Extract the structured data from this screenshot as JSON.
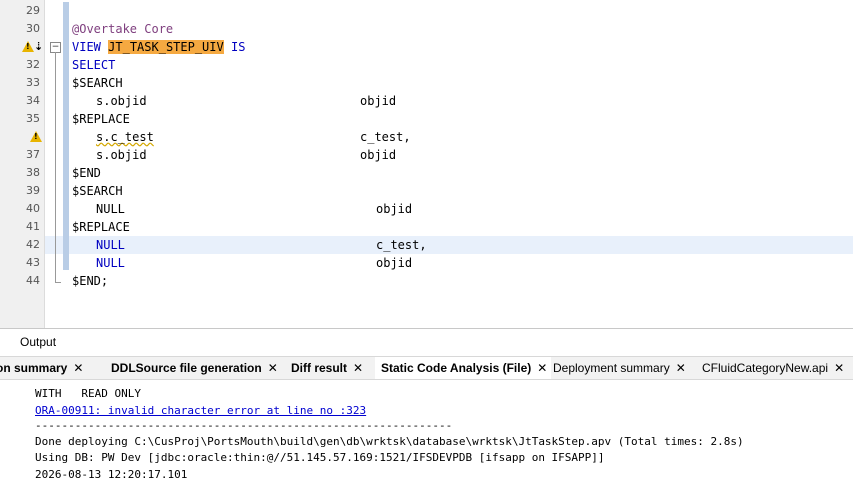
{
  "editor": {
    "lines": [
      {
        "n": "29",
        "t": ""
      },
      {
        "n": "30",
        "t": "@Overtake Core"
      },
      {
        "n": "",
        "t": "VIEW JT_TASK_STEP_UIV IS"
      },
      {
        "n": "32",
        "t": "SELECT"
      },
      {
        "n": "33",
        "t": "$SEARCH"
      },
      {
        "n": "34",
        "t": "   s.objid                               objid"
      },
      {
        "n": "35",
        "t": "$REPLACE"
      },
      {
        "n": "",
        "t": "   s.c_test                              c_test,"
      },
      {
        "n": "37",
        "t": "   s.objid                               objid"
      },
      {
        "n": "38",
        "t": "$END"
      },
      {
        "n": "39",
        "t": "$SEARCH"
      },
      {
        "n": "40",
        "t": "   NULL                                    objid"
      },
      {
        "n": "41",
        "t": "$REPLACE"
      },
      {
        "n": "42",
        "t": "   NULL                                    c_test,"
      },
      {
        "n": "43",
        "t": "   NULL                                    objid"
      },
      {
        "n": "44",
        "t": "$END;"
      }
    ],
    "view_keyword": "VIEW",
    "view_name": "JT_TASK_STEP_UIV",
    "view_is": "IS",
    "annotation": "@Overtake Core",
    "col_objid": "objid",
    "col_ctest": "c_test,",
    "s_objid": "s.objid",
    "s_ctest": "s.c_test",
    "null_kw": "NULL",
    "fold_minus": "−",
    "warning_icon_name": "warning-icon",
    "highlight_color": "#f5a941",
    "keyword_color": "#0000c0"
  },
  "output": {
    "title": "Output",
    "tabs": [
      {
        "label": "on summary",
        "close": "✕"
      },
      {
        "label": "DDLSource file generation",
        "close": "✕"
      },
      {
        "label": "Diff result",
        "close": "✕"
      },
      {
        "label": "Static Code Analysis (File)",
        "close": "✕"
      },
      {
        "label": "Deployment summary",
        "close": "✕"
      },
      {
        "label": "CFluidCategoryNew.api",
        "close": "✕"
      }
    ],
    "lines": [
      "WITH   READ ONLY",
      "ORA-00911: invalid character error at line no :323",
      "---------------------------------------------------------------",
      "Done deploying C:\\CusProj\\PortsMouth\\build\\gen\\db\\wrktsk\\database\\wrktsk\\JtTaskStep.apv (Total times: 2.8s)",
      "Using DB: PW Dev [jdbc:oracle:thin:@//51.145.57.169:1521/IFSDEVPDB [ifsapp on IFSAPP]]",
      "2026-08-13 12:20:17.101"
    ]
  }
}
